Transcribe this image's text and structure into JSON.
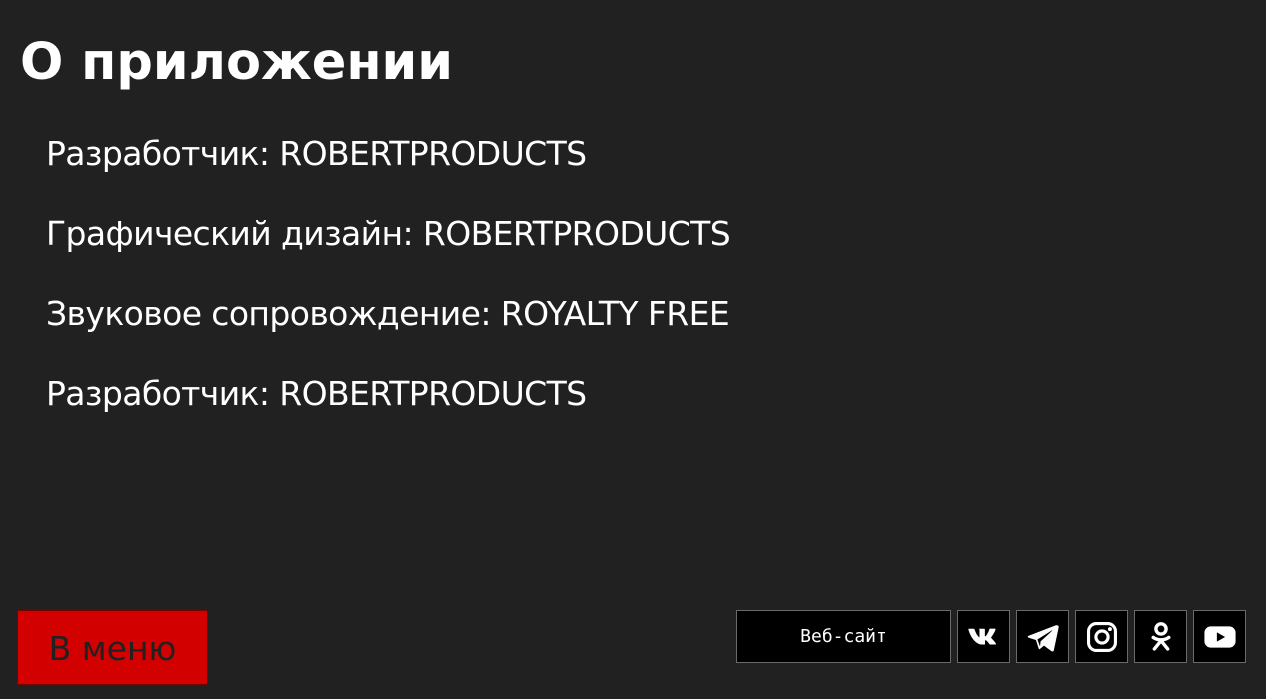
{
  "page": {
    "title": "О приложении"
  },
  "credits": [
    "Разработчик: ROBERTPRODUCTS",
    "Графический дизайн: ROBERTPRODUCTS",
    "Звуковое сопровождение: ROYALTY FREE",
    "Разработчик: ROBERTPRODUCTS"
  ],
  "buttons": {
    "menu_label": "В меню",
    "website_label": "Веб-сайт"
  },
  "social": [
    {
      "icon": "vk-icon"
    },
    {
      "icon": "telegram-icon"
    },
    {
      "icon": "instagram-icon"
    },
    {
      "icon": "odnoklassniki-icon"
    },
    {
      "icon": "youtube-icon"
    }
  ],
  "colors": {
    "background": "#212121",
    "menu_button": "#d30000",
    "social_button": "#000000",
    "text": "#ffffff"
  }
}
